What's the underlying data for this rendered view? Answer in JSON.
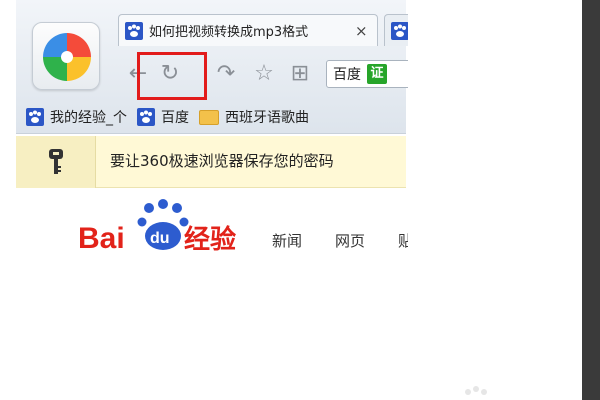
{
  "browser": {
    "tabs": [
      {
        "title": "如何把视频转换成mp3格式",
        "close": "×"
      },
      {
        "title": ""
      }
    ],
    "search": {
      "engine": "百度",
      "badge": "证"
    },
    "bookmarks": [
      {
        "label": "我的经验_个",
        "icon": "paw-icon"
      },
      {
        "label": "百度",
        "icon": "paw-icon"
      },
      {
        "label": "西班牙语歌曲",
        "icon": "folder-icon"
      }
    ],
    "infobar": {
      "text": "要让360极速浏览器保存您的密码"
    },
    "icons": {
      "back": "←",
      "reload": "↻",
      "forward": "↷",
      "star": "☆",
      "grid": "⊞"
    }
  },
  "page": {
    "logo": {
      "part1": "Bai",
      "du": "du",
      "part2": "经验"
    },
    "nav": [
      {
        "label": "新闻"
      },
      {
        "label": "网页"
      },
      {
        "label": "贴"
      }
    ]
  },
  "colors": {
    "highlight": "#e21b1b",
    "baidu_red": "#e2231a",
    "baidu_blue": "#2d5ccf",
    "badge_green": "#27a52a"
  }
}
